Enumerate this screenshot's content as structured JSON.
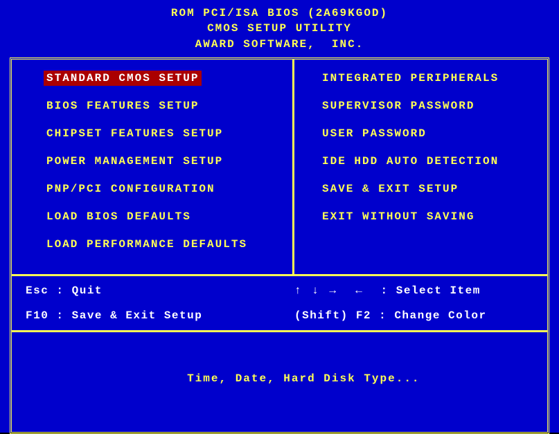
{
  "header": {
    "line1": "ROM PCI/ISA BIOS (2A69KGOD)",
    "line2": "CMOS SETUP UTILITY",
    "line3": "AWARD SOFTWARE,  INC."
  },
  "menu": {
    "left": [
      "STANDARD CMOS SETUP",
      "BIOS FEATURES SETUP",
      "CHIPSET FEATURES SETUP",
      "POWER MANAGEMENT SETUP",
      "PNP/PCI CONFIGURATION",
      "LOAD BIOS DEFAULTS",
      "LOAD PERFORMANCE DEFAULTS"
    ],
    "right": [
      "INTEGRATED PERIPHERALS",
      "SUPERVISOR PASSWORD",
      "USER PASSWORD",
      "IDE HDD AUTO DETECTION",
      "SAVE & EXIT SETUP",
      "EXIT WITHOUT SAVING"
    ],
    "selected_index": 0
  },
  "hints": {
    "esc": "Esc : Quit",
    "f10": "F10 : Save & Exit Setup",
    "arrows_label": " : Select Item",
    "shift_f2": "(Shift) F2 : Change Color"
  },
  "description": "Time, Date, Hard Disk Type..."
}
